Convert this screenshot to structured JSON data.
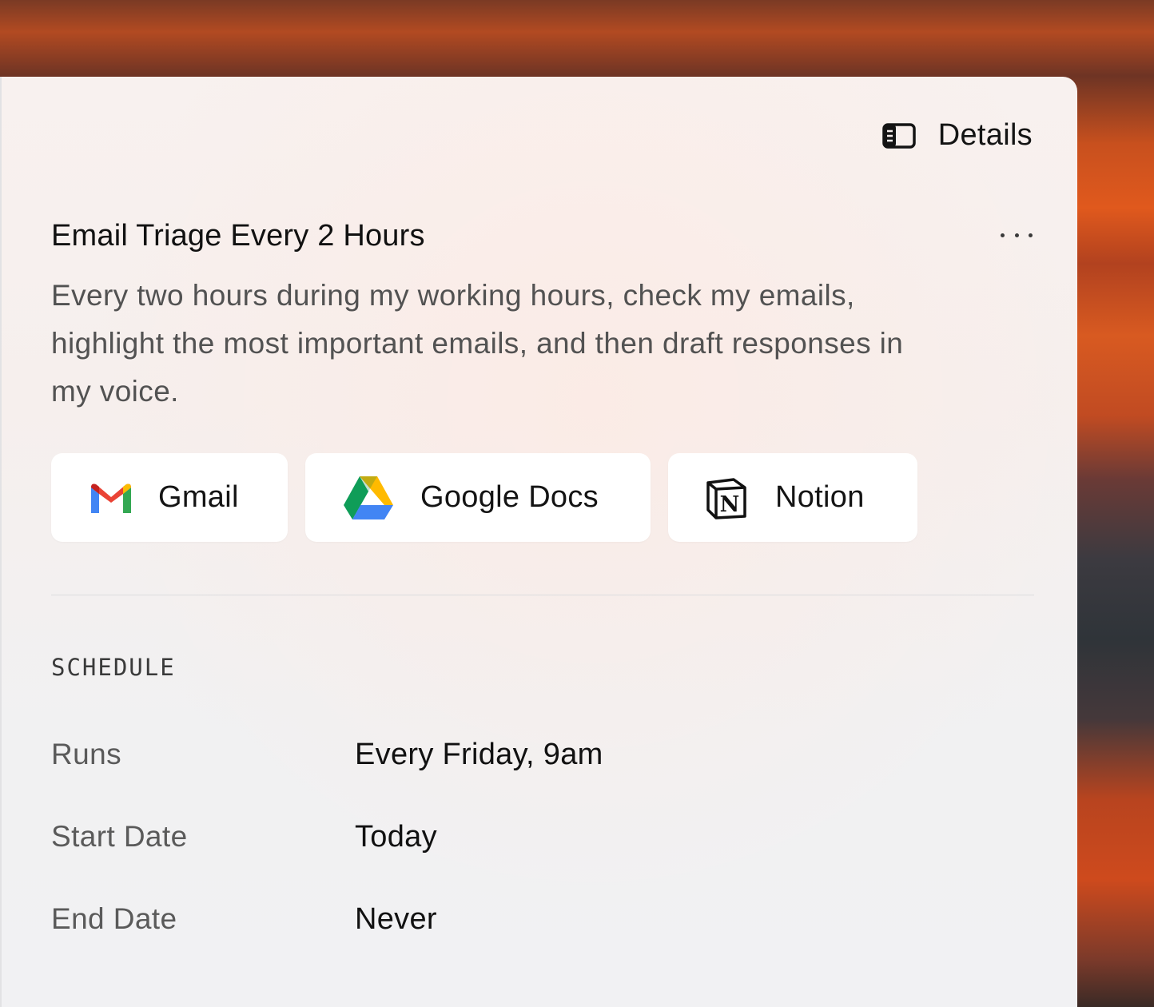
{
  "header": {
    "details_label": "Details",
    "details_icon": "sidebar-panel-icon"
  },
  "task": {
    "title": "Email Triage Every 2 Hours",
    "more_icon": "more-horizontal-icon",
    "description": "Every two hours during my working hours, check my emails, highlight the most important emails, and then draft responses in my voice."
  },
  "integrations": [
    {
      "label": "Gmail",
      "icon": "gmail-icon"
    },
    {
      "label": "Google Docs",
      "icon": "google-drive-icon"
    },
    {
      "label": "Notion",
      "icon": "notion-icon"
    }
  ],
  "schedule": {
    "heading": "SCHEDULE",
    "rows": [
      {
        "label": "Runs",
        "value": "Every Friday, 9am"
      },
      {
        "label": "Start Date",
        "value": "Today"
      },
      {
        "label": "End Date",
        "value": "Never"
      }
    ]
  },
  "colors": {
    "panel_background": "#f4f0ef",
    "chip_background": "#ffffff",
    "text_primary": "#111111",
    "text_secondary": "#525252",
    "backdrop_accent": "#d85a21"
  }
}
